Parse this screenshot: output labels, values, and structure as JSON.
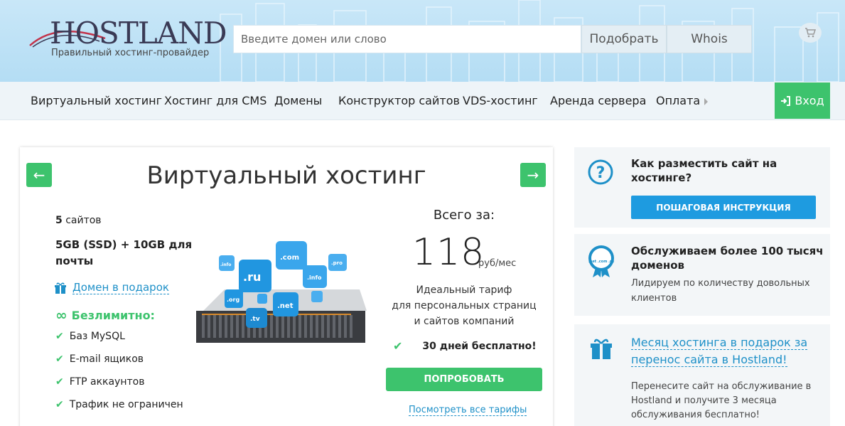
{
  "header": {
    "logo_text": "HOSTLAND",
    "logo_subtitle": "Правильный хостинг-провайдер",
    "search_placeholder": "Введите домен или слово",
    "pick_button": "Подобрать",
    "whois_button": "Whois",
    "cart_icon": "cart-icon"
  },
  "nav": {
    "items": [
      "Виртуальный хостинг",
      "Хостинг для CMS",
      "Домены",
      "Конструктор сайтов",
      "VDS-хостинг",
      "Аренда сервера",
      "Оплата"
    ],
    "login_label": "Вход"
  },
  "card": {
    "prev_arrow": "←",
    "next_arrow": "→",
    "title": "Виртуальный хостинг",
    "sites_count": "5",
    "sites_label": "сайтов",
    "storage_line1": "5GB (SSD) + 10GB для",
    "storage_line2": "почты",
    "gift_domain": "Домен в подарок",
    "unlimited": "Безлимитно:",
    "unlimited_items": [
      "Баз MySQL",
      "E-mail ящиков",
      "FTP аккаунтов",
      "Трафик не ограничен"
    ],
    "price_label": "Всего за:",
    "price": "118",
    "price_unit": "руб/мес",
    "desc_line1": "Идеальный тариф",
    "desc_line2": "для персональных страниц",
    "desc_line3": "и сайтов компаний",
    "free_days": "30 дней бесплатно!",
    "try_button": "ПОПРОБОВАТЬ",
    "all_tariffs": "Посмотреть все тарифы",
    "domain_labels": [
      ".ru",
      ".com",
      ".info",
      ".org",
      ".tv",
      ".net",
      ".info",
      ".pro"
    ]
  },
  "panels": {
    "help_title_line1": "Как разместить сайт на",
    "help_title_line2": "хостинге?",
    "help_button": "ПОШАГОВАЯ ИНСТРУКЦИЯ",
    "badge_text": ".net .com .ru",
    "domains_title_line1": "Обслуживаем более 100 тысяч",
    "domains_title_line2": "доменов",
    "domains_text_line1": "Лидируем по количеству довольных",
    "domains_text_line2": "клиентов",
    "gift_link_line1": "Месяц хостинга в подарок за",
    "gift_link_line2": "перенос сайта в Hostland!",
    "gift_text_line1": "Перенесите сайт на обслуживание в",
    "gift_text_line2": "Hostland и получите 3 месяца",
    "gift_text_line3": "обслуживания бесплатно!"
  },
  "colors": {
    "green": "#3dc36d",
    "blue": "#1e90c8",
    "header_bg": "#c9e7f8"
  }
}
